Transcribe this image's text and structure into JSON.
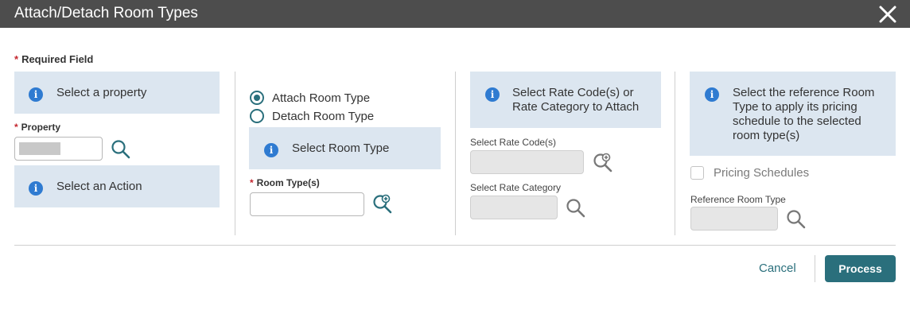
{
  "dialog": {
    "title": "Attach/Detach Room Types"
  },
  "required_note": {
    "star": "*",
    "text": "Required Field"
  },
  "col1": {
    "info_property": "Select a property",
    "property_label": "Property",
    "property_value": "",
    "info_action": "Select an Action"
  },
  "col2": {
    "radio_attach": "Attach Room Type",
    "radio_detach": "Detach Room Type",
    "selected": "attach",
    "info_room_type": "Select Room Type",
    "room_types_label": "Room Type(s)",
    "room_types_value": ""
  },
  "col3": {
    "info_rate_line1": "Select Rate Code(s) or",
    "info_rate_line2": "Rate Category to Attach",
    "rate_codes_label": "Select Rate Code(s)",
    "rate_category_label": "Select Rate Category"
  },
  "col4": {
    "info_ref_line1": "Select the reference Room",
    "info_ref_line2": "Type to apply its pricing",
    "info_ref_line3": "schedule to the selected",
    "info_ref_line4": "room type(s)",
    "pricing_schedules_label": "Pricing Schedules",
    "ref_room_type_label": "Reference Room Type"
  },
  "footer": {
    "cancel_label": "Cancel",
    "process_label": "Process"
  },
  "icons": {
    "info": "info-icon",
    "search": "search-icon",
    "search_plus": "search-plus-icon",
    "close": "close-icon"
  },
  "colors": {
    "titlebar": "#4d4d4d",
    "accent": "#2a6f7c",
    "info_panel": "#dce6f0",
    "info_icon": "#2f7bd1",
    "required": "#c4262e"
  }
}
